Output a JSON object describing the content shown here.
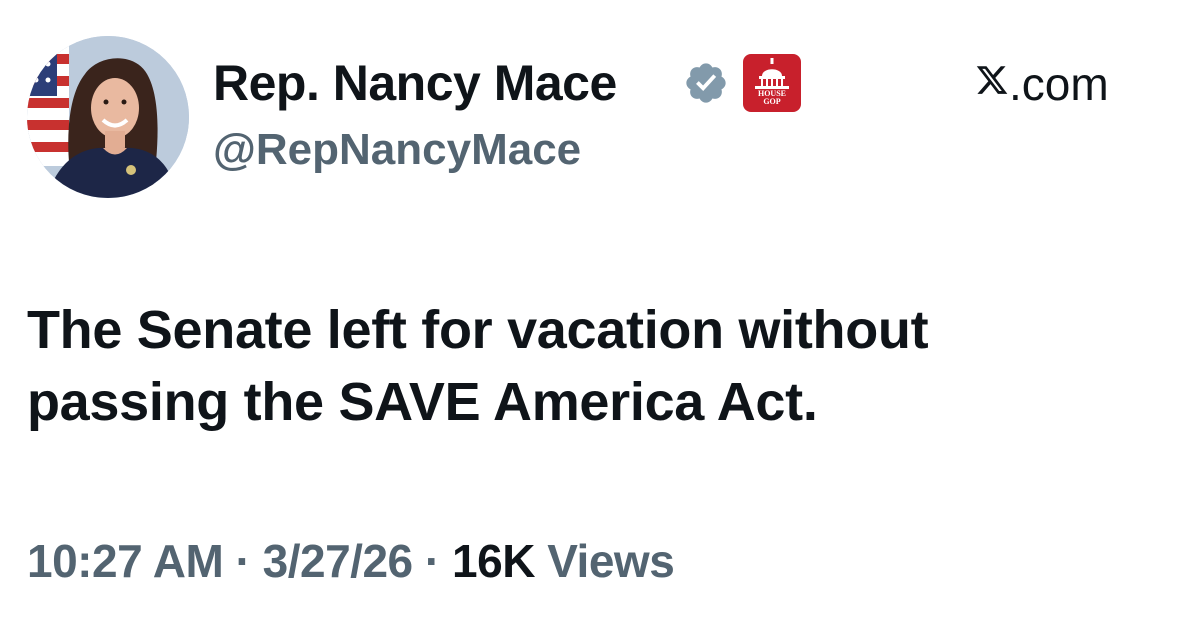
{
  "author": {
    "display_name": "Rep. Nancy Mace",
    "handle": "@RepNancyMace",
    "verified": true,
    "verified_badge_color": "#829aab",
    "affiliate_badge": {
      "label_line1": "HOUSE",
      "label_line2": "GOP",
      "color": "#c8202c"
    }
  },
  "site": {
    "label": ".com"
  },
  "tweet": {
    "text_line1": "The Senate left for vacation without",
    "text_line2": "passing the SAVE America Act."
  },
  "meta": {
    "time": "10:27 AM",
    "separator": "·",
    "date": "3/27/26",
    "views_count": "16K",
    "views_label": "Views"
  },
  "colors": {
    "text_primary": "#0f1419",
    "text_secondary": "#536471"
  }
}
